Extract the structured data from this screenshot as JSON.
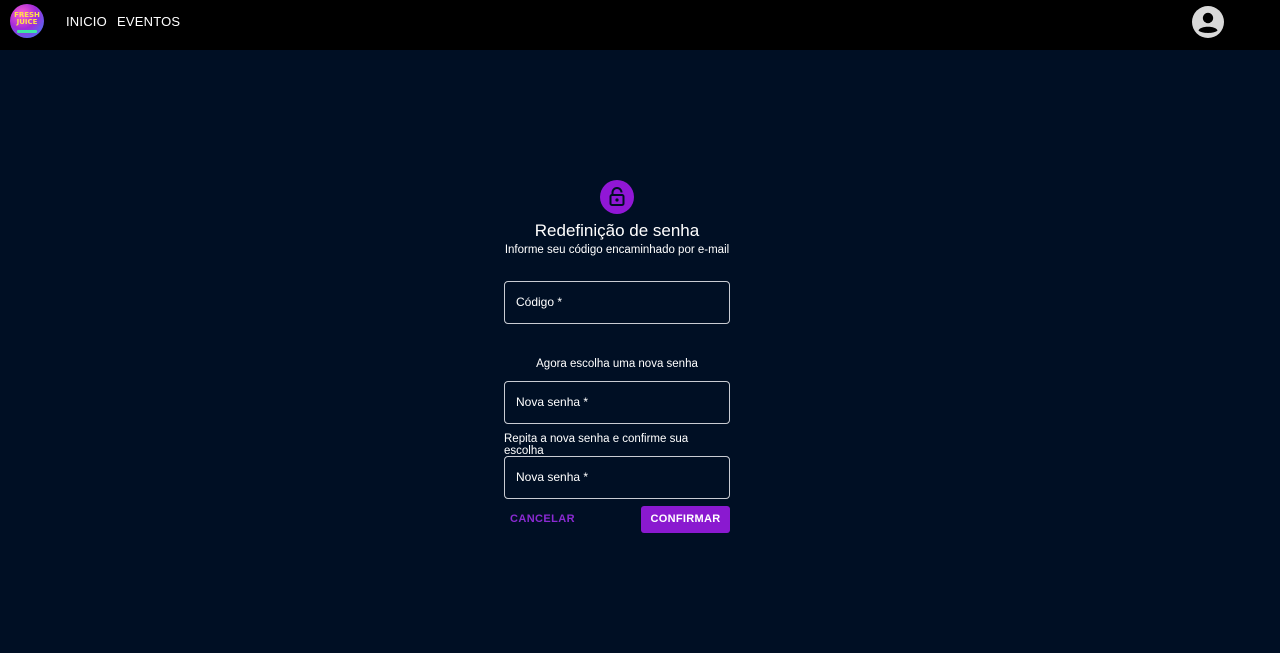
{
  "header": {
    "logo_text": "FRESH JUICE",
    "nav": [
      {
        "label": "INICIO"
      },
      {
        "label": "EVENTOS"
      }
    ],
    "account_icon": "account-circle-icon"
  },
  "form": {
    "icon": "lock-open-icon",
    "title": "Redefinição de senha",
    "subtitle": "Informe seu código encaminhado por e-mail",
    "code_field": {
      "label": "Código *",
      "value": ""
    },
    "new_password_hint": "Agora escolha uma nova senha",
    "new_password_field": {
      "label": "Nova senha *",
      "value": ""
    },
    "repeat_hint": "Repita a nova senha e confirme sua escolha",
    "repeat_password_field": {
      "label": "Nova senha *",
      "value": ""
    },
    "cancel_label": "CANCELAR",
    "confirm_label": "CONFIRMAR"
  },
  "colors": {
    "background": "#000f24",
    "header": "#000000",
    "accent": "#8a19d0"
  }
}
